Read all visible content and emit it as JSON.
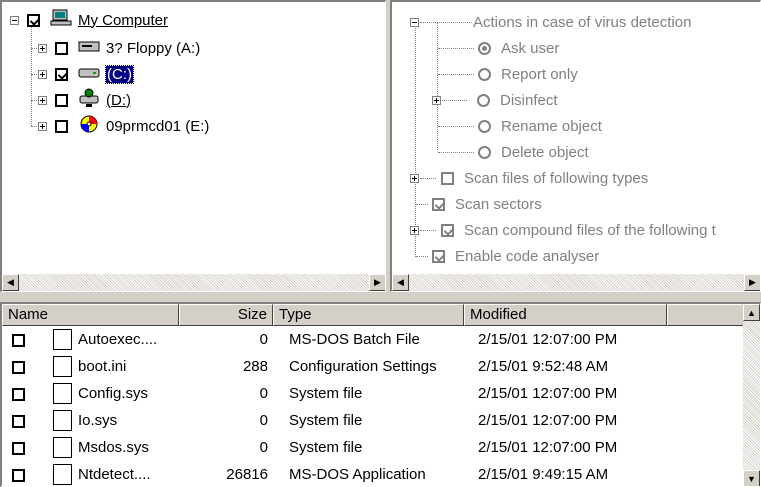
{
  "tree": {
    "root_label": "My Computer",
    "drives": [
      {
        "label": "3? Floppy (A:)",
        "checked": false
      },
      {
        "label": "(C:)",
        "checked": true
      },
      {
        "label": "(D:)",
        "checked": false
      },
      {
        "label": "09prmcd01 (E:)",
        "checked": false
      }
    ]
  },
  "options": {
    "actions_label": "Actions in case of virus detection",
    "radios": [
      "Ask user",
      "Report only",
      "Disinfect",
      "Rename object",
      "Delete object"
    ],
    "checks": [
      {
        "label": "Scan files of following types",
        "checked": false
      },
      {
        "label": "Scan sectors",
        "checked": true
      },
      {
        "label": "Scan compound files of the following t",
        "checked": true
      },
      {
        "label": "Enable code analyser",
        "checked": true
      }
    ]
  },
  "list": {
    "columns": [
      "Name",
      "Size",
      "Type",
      "Modified"
    ],
    "rows": [
      {
        "name": "Autoexec....",
        "size": "0",
        "type": "MS-DOS Batch File",
        "modified": "2/15/01 12:07:00 PM"
      },
      {
        "name": "boot.ini",
        "size": "288",
        "type": "Configuration Settings",
        "modified": "2/15/01 9:52:48 AM"
      },
      {
        "name": "Config.sys",
        "size": "0",
        "type": "System file",
        "modified": "2/15/01 12:07:00 PM"
      },
      {
        "name": "Io.sys",
        "size": "0",
        "type": "System file",
        "modified": "2/15/01 12:07:00 PM"
      },
      {
        "name": "Msdos.sys",
        "size": "0",
        "type": "System file",
        "modified": "2/15/01 12:07:00 PM"
      },
      {
        "name": "Ntdetect....",
        "size": "26816",
        "type": "MS-DOS Application",
        "modified": "2/15/01 9:49:15 AM"
      }
    ]
  }
}
